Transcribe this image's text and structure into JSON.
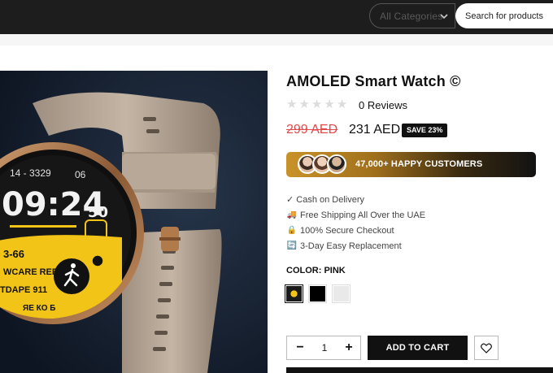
{
  "header": {
    "category_select": {
      "value": "All Categories"
    },
    "search": {
      "placeholder": "Search for products"
    }
  },
  "product": {
    "image_alt": "AMOLED Smart Watch",
    "watch_face": {
      "date": "14 - 3329",
      "date_suffix": "06",
      "time": "09:24",
      "seconds": "50",
      "row1": "3-66",
      "row2": "WCARE REB",
      "row3": "TDAPE 911",
      "row4": "ЯЕ КО Б"
    },
    "title": "AMOLED Smart Watch ©",
    "rating": 0,
    "reviews_label": "0 Reviews",
    "price_old": "299 AED",
    "price_new": "231 AED",
    "save_badge": "SAVE 23%",
    "happy_customers": "47,000+ HAPPY CUSTOMERS",
    "features": [
      {
        "icon": "check-icon",
        "text": "✓ Cash on Delivery"
      },
      {
        "icon": "truck-icon",
        "text": "Free Shipping All Over the UAE"
      },
      {
        "icon": "lock-icon",
        "text": "100% Secure Checkout"
      },
      {
        "icon": "replace-icon",
        "text": "3-Day Easy Replacement"
      }
    ],
    "color_label": "COLOR:",
    "color_value": "PINK",
    "swatches": [
      {
        "name": "watch-thumbnail",
        "color": "#1a1a1a"
      },
      {
        "name": "black",
        "color": "#000000"
      },
      {
        "name": "white",
        "color": "#e9e9e9"
      }
    ],
    "quantity": "1",
    "minus_label": "−",
    "plus_label": "+",
    "add_to_cart_label": "ADD TO CART"
  },
  "colors": {
    "header_bg": "#1d1d1d",
    "accent_gold": "#c9922a",
    "price_old": "#e24a4a",
    "dark_button": "#111111"
  }
}
